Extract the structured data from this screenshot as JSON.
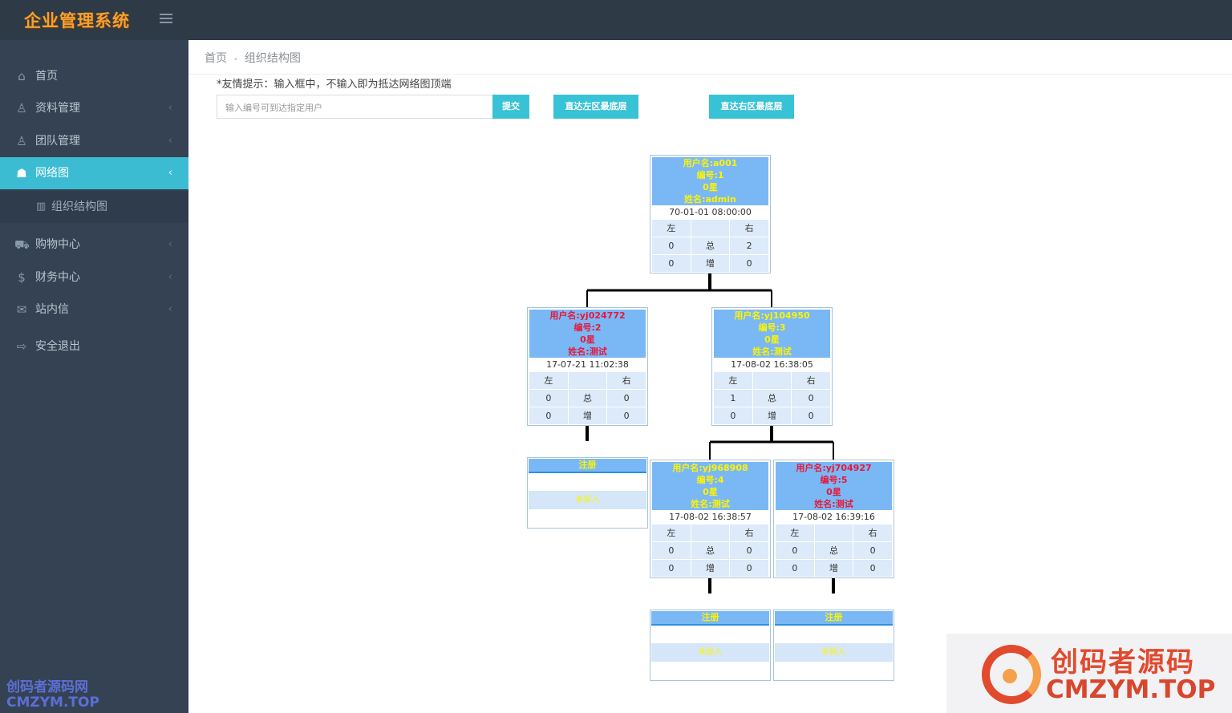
{
  "app": {
    "logo_text": "企业管理系统"
  },
  "sidebar": {
    "items": [
      {
        "label": "首页",
        "icon": "home-icon",
        "chevron": ""
      },
      {
        "label": "资料管理",
        "icon": "user-icon",
        "chevron": "‹"
      },
      {
        "label": "团队管理",
        "icon": "team-icon",
        "chevron": "‹"
      },
      {
        "label": "网络图",
        "icon": "sitemap-icon",
        "chevron": "‹"
      },
      {
        "label": "购物中心",
        "icon": "truck-icon",
        "chevron": "‹"
      },
      {
        "label": "财务中心",
        "icon": "dollar-icon",
        "chevron": "‹"
      },
      {
        "label": "站内信",
        "icon": "mail-icon",
        "chevron": "‹"
      },
      {
        "label": "安全退出",
        "icon": "logout-icon",
        "chevron": ""
      }
    ],
    "sub_item": {
      "label": "组织结构图",
      "icon": "bar-chart-icon"
    },
    "watermark_cn": "创码者源码网",
    "watermark_en": "CMZYM.TOP"
  },
  "breadcrumb": {
    "home": "首页",
    "sep": "•",
    "current": "组织结构图"
  },
  "tip": "*友情提示：输入框中，不输入即为抵达网络图顶端",
  "search": {
    "placeholder": "输入编号可到达指定用户",
    "submit": "提交"
  },
  "buttons": {
    "left_bottom": "直达左区最底层",
    "right_bottom": "直达右区最底层"
  },
  "labels": {
    "left": "左",
    "right": "右",
    "total": "总",
    "increase": "增",
    "register": "注册",
    "empty_mid": "未投入"
  },
  "nodes": [
    {
      "username": "用户名:a001",
      "number": "编号:1",
      "star": "0星",
      "name": "姓名:admin",
      "date": "70-01-01 08:00:00",
      "total_left": "0",
      "total_right": "2",
      "inc_left": "0",
      "inc_right": "0",
      "color": "#fff300"
    },
    {
      "username": "用户名:yj024772",
      "number": "编号:2",
      "star": "0星",
      "name": "姓名:测试",
      "date": "17-07-21 11:02:38",
      "total_left": "0",
      "total_right": "0",
      "inc_left": "0",
      "inc_right": "0",
      "color": "#e8173a"
    },
    {
      "username": "用户名:yj104950",
      "number": "编号:3",
      "star": "0星",
      "name": "姓名:测试",
      "date": "17-08-02 16:38:05",
      "total_left": "1",
      "total_right": "0",
      "inc_left": "0",
      "inc_right": "0",
      "color": "#fff300"
    },
    {
      "username": "用户名:yj968908",
      "number": "编号:4",
      "star": "0星",
      "name": "姓名:测试",
      "date": "17-08-02 16:38:57",
      "total_left": "0",
      "total_right": "0",
      "inc_left": "0",
      "inc_right": "0",
      "color": "#fff300"
    },
    {
      "username": "用户名:yj704927",
      "number": "编号:5",
      "star": "0星",
      "name": "姓名:测试",
      "date": "17-08-02 16:39:16",
      "total_left": "0",
      "total_right": "0",
      "inc_left": "0",
      "inc_right": "0",
      "color": "#e8173a"
    }
  ],
  "corner_watermark": {
    "cn": "创码者源码",
    "en": "CMZYM.TOP"
  }
}
